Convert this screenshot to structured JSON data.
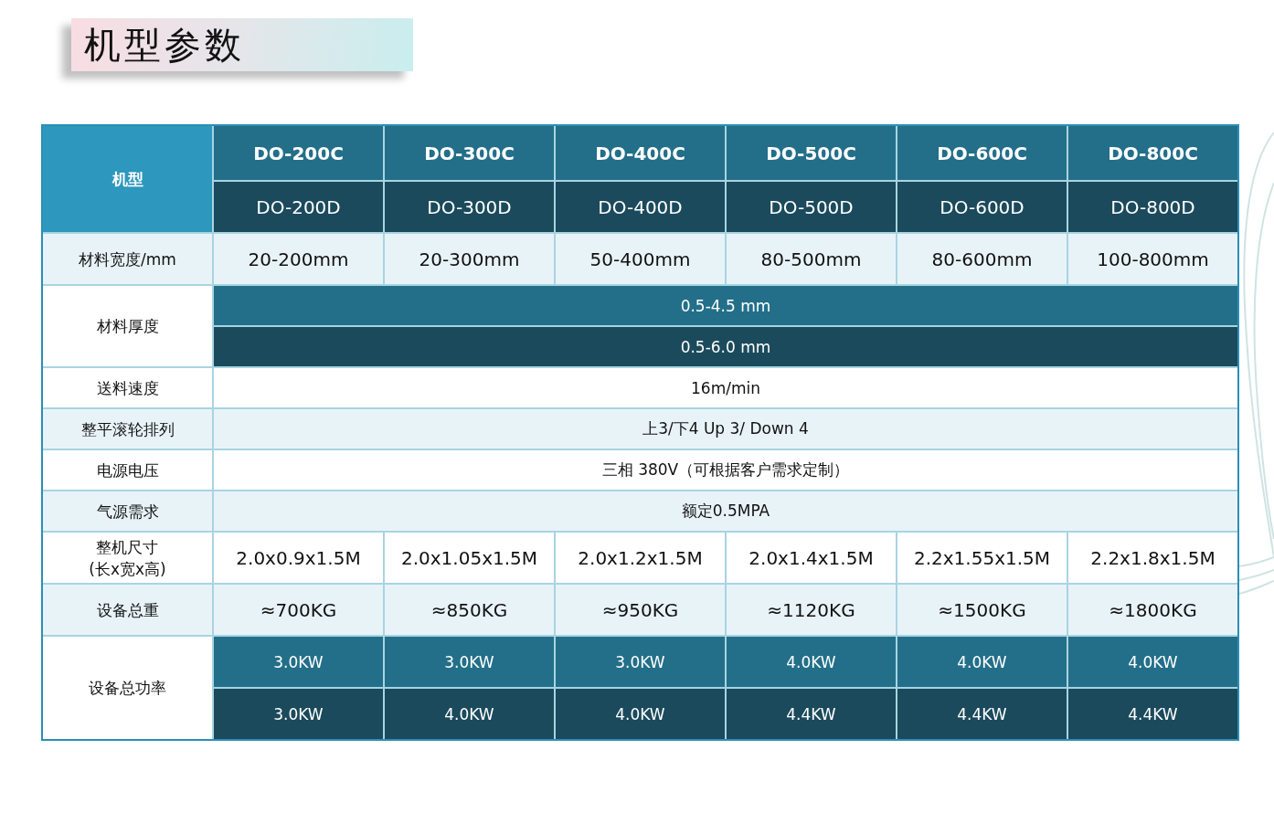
{
  "title": "机型参数",
  "table": {
    "corner": "机型",
    "models_c": [
      "DO-200C",
      "DO-300C",
      "DO-400C",
      "DO-500C",
      "DO-600C",
      "DO-800C"
    ],
    "models_d": [
      "DO-200D",
      "DO-300D",
      "DO-400D",
      "DO-500D",
      "DO-600D",
      "DO-800D"
    ],
    "rows": [
      {
        "kind": "per_model",
        "label": "材料宽度/mm",
        "values": [
          "20-200mm",
          "20-300mm",
          "50-400mm",
          "80-500mm",
          "80-600mm",
          "100-800mm"
        ]
      },
      {
        "kind": "span_split",
        "label": "材料厚度",
        "values": [
          "0.5-4.5 mm",
          "0.5-6.0 mm"
        ]
      },
      {
        "kind": "span",
        "label": "送料速度",
        "value": "16m/min"
      },
      {
        "kind": "span",
        "label": "整平滚轮排列",
        "value": "上3/下4   Up 3/ Down 4"
      },
      {
        "kind": "span",
        "label": "电源电压",
        "value": "三相 380V（可根据客户需求定制）"
      },
      {
        "kind": "span",
        "label": "气源需求",
        "value": "额定0.5MPA"
      },
      {
        "kind": "per_model",
        "label": "整机尺寸\n(长x宽x高)",
        "values": [
          "2.0x0.9x1.5M",
          "2.0x1.05x1.5M",
          "2.0x1.2x1.5M",
          "2.0x1.4x1.5M",
          "2.2x1.55x1.5M",
          "2.2x1.8x1.5M"
        ]
      },
      {
        "kind": "per_model",
        "label": "设备总重",
        "values": [
          "≈700KG",
          "≈850KG",
          "≈950KG",
          "≈1120KG",
          "≈1500KG",
          "≈1800KG"
        ]
      },
      {
        "kind": "per_model_split",
        "label": "设备总功率",
        "values": [
          [
            "3.0KW",
            "3.0KW",
            "3.0KW",
            "4.0KW",
            "4.0KW",
            "4.0KW"
          ],
          [
            "3.0KW",
            "4.0KW",
            "4.0KW",
            "4.4KW",
            "4.4KW",
            "4.4KW"
          ]
        ]
      }
    ]
  }
}
